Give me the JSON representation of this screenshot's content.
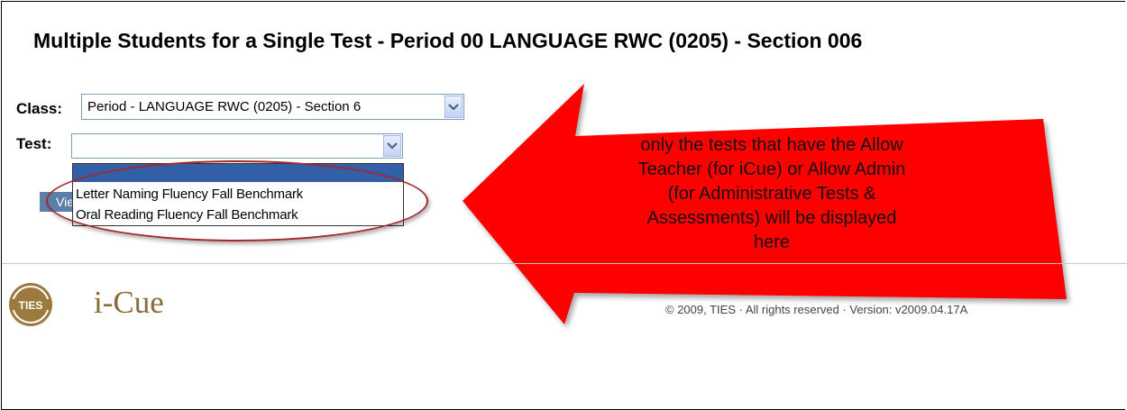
{
  "page": {
    "title": "Multiple Students for a Single Test - Period 00 LANGUAGE RWC (0205) - Section 006"
  },
  "form": {
    "class_label": "Class:",
    "class_value": "Period - LANGUAGE RWC (0205) - Section 6",
    "test_label": "Test:",
    "test_value": "",
    "test_options": [
      "",
      "Letter Naming Fluency Fall Benchmark",
      "Oral Reading Fluency Fall Benchmark"
    ],
    "view_label": "View"
  },
  "callout": {
    "lines": [
      "only the tests that have the Allow",
      "Teacher (for iCue) or Allow Admin",
      "(for Administrative Tests &",
      "Assessments) will be displayed",
      "here"
    ],
    "color": "#ff0000"
  },
  "footer": {
    "logo_badge": "TIES",
    "logo_text": "i-Cue",
    "copyright": "© 2009, TIES · All rights reserved · Version: v2009.04.17A"
  }
}
